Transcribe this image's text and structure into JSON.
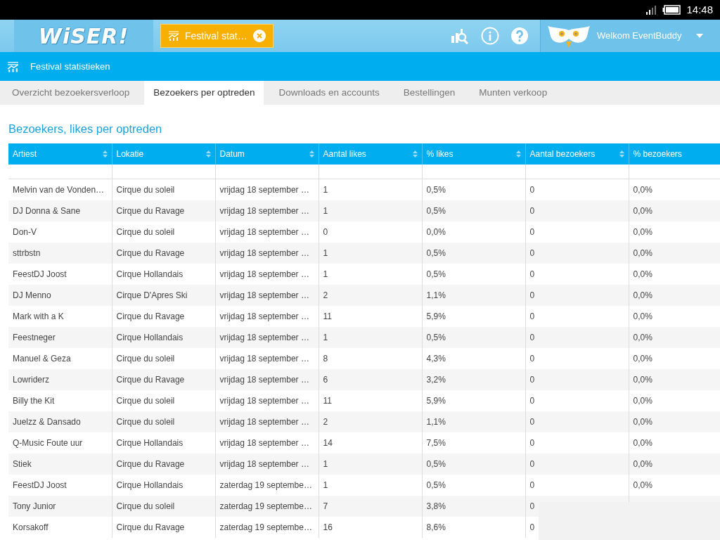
{
  "status_bar": {
    "time": "14:48"
  },
  "top_bar": {
    "logo": "WiSER!",
    "open_tab": {
      "label": "Festival stat…"
    },
    "user": "Welkom EventBuddy"
  },
  "page_header": {
    "title": "Festival statistieken"
  },
  "tabs": [
    {
      "label": "Overzicht bezoekersverloop",
      "selected": false
    },
    {
      "label": "Bezoekers per optreden",
      "selected": true
    },
    {
      "label": "Downloads en accounts",
      "selected": false
    },
    {
      "label": "Bestellingen",
      "selected": false
    },
    {
      "label": "Munten verkoop",
      "selected": false
    }
  ],
  "section_title": "Bezoekers, likes per optreden",
  "table": {
    "columns": [
      {
        "label": "Artiest",
        "sortable": true
      },
      {
        "label": "Lokatie",
        "sortable": true
      },
      {
        "label": "Datum",
        "sortable": true
      },
      {
        "label": "Aantal likes",
        "sortable": true
      },
      {
        "label": "% likes",
        "sortable": true
      },
      {
        "label": "Aantal bezoekers",
        "sortable": true
      },
      {
        "label": "% bezoekers",
        "sortable": false
      }
    ],
    "rows": [
      [
        "Melvin van de Vonden…",
        "Cirque du soleil",
        "vrijdag 18 september …",
        "1",
        "0,5%",
        "0",
        "0,0%"
      ],
      [
        "DJ Donna & Sane",
        "Cirque du Ravage",
        "vrijdag 18 september …",
        "1",
        "0,5%",
        "0",
        "0,0%"
      ],
      [
        "Don-V",
        "Cirque du soleil",
        "vrijdag 18 september …",
        "0",
        "0,0%",
        "0",
        "0,0%"
      ],
      [
        "sttrbstn",
        "Cirque du Ravage",
        "vrijdag 18 september …",
        "1",
        "0,5%",
        "0",
        "0,0%"
      ],
      [
        "FeestDJ Joost",
        "Cirque Hollandais",
        "vrijdag 18 september …",
        "1",
        "0,5%",
        "0",
        "0,0%"
      ],
      [
        "DJ Menno",
        "Cirque D'Apres Ski",
        "vrijdag 18 september …",
        "2",
        "1,1%",
        "0",
        "0,0%"
      ],
      [
        "Mark with a K",
        "Cirque du Ravage",
        "vrijdag 18 september …",
        "11",
        "5,9%",
        "0",
        "0,0%"
      ],
      [
        "Feestneger",
        "Cirque Hollandais",
        "vrijdag 18 september …",
        "1",
        "0,5%",
        "0",
        "0,0%"
      ],
      [
        "Manuel & Geza",
        "Cirque du soleil",
        "vrijdag 18 september …",
        "8",
        "4,3%",
        "0",
        "0,0%"
      ],
      [
        "Lowriderz",
        "Cirque du Ravage",
        "vrijdag 18 september …",
        "6",
        "3,2%",
        "0",
        "0,0%"
      ],
      [
        "Billy the Kit",
        "Cirque du soleil",
        "vrijdag 18 september …",
        "11",
        "5,9%",
        "0",
        "0,0%"
      ],
      [
        "Juelzz & Dansado",
        "Cirque du soleil",
        "vrijdag 18 september …",
        "2",
        "1,1%",
        "0",
        "0,0%"
      ],
      [
        "Q-Music Foute uur",
        "Cirque Hollandais",
        "vrijdag 18 september …",
        "14",
        "7,5%",
        "0",
        "0,0%"
      ],
      [
        "Stiek",
        "Cirque du Ravage",
        "vrijdag 18 september …",
        "1",
        "0,5%",
        "0",
        "0,0%"
      ],
      [
        "FeestDJ Joost",
        "Cirque Hollandais",
        "zaterdag 19 septembe…",
        "1",
        "0,5%",
        "0",
        "0,0%"
      ],
      [
        "Tony Junior",
        "Cirque du soleil",
        "zaterdag 19 septembe…",
        "7",
        "3,8%",
        "0"
      ],
      [
        "Korsakoff",
        "Cirque du Ravage",
        "zaterdag 19 septembe…",
        "16",
        "8,6%",
        "0"
      ]
    ]
  }
}
